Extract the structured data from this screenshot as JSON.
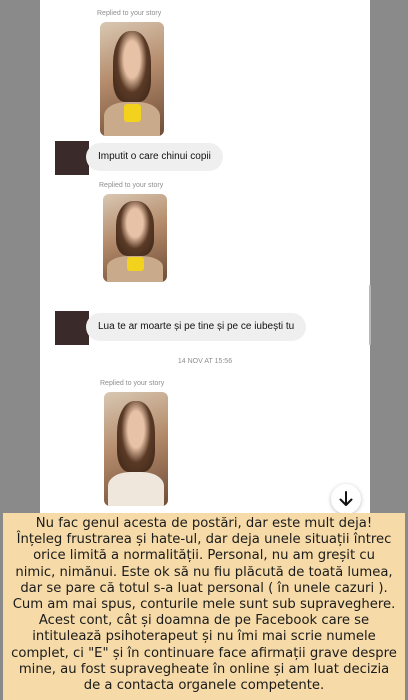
{
  "chat": {
    "messages": [
      {
        "reply_label": "Replied to your story",
        "story_tags": [],
        "text": "Imputit o care chinui copii"
      },
      {
        "reply_label": "Replied to your story",
        "story_tags": [],
        "text": "Lua te ar moarte și pe tine și pe ce iubești tu"
      },
      {
        "reply_label": "Replied to your story",
        "story_tags": [
          "",
          ""
        ]
      }
    ],
    "timestamp": "14 NOV AT 15:56"
  },
  "scroll_down_icon": "arrow-down-icon",
  "caption": {
    "text": "Nu fac genul acesta de postări, dar este mult deja! Înțeleg frustrarea și hate-ul, dar deja unele situații întrec orice limită a normalității. Personal, nu am greșit cu nimic, nimănui. Este ok să nu fiu plăcută de toată lumea, dar se pare că totul s-a luat personal ( în unele cazuri ). Cum am mai spus, conturile mele sunt sub supraveghere. Acest cont,  cât și doamna de pe Facebook care se intitulează psihoterapeut și nu îmi mai scrie numele complet, ci \"E\" și în continuare face afirmații grave despre mine, au fost supravegheate în online și am luat decizia de a contacta organele competente."
  },
  "colors": {
    "background": "#8a8a8a",
    "bubble": "#efefef",
    "caption_bg": "#f6dba8",
    "meta_text": "#8e8e8e"
  }
}
